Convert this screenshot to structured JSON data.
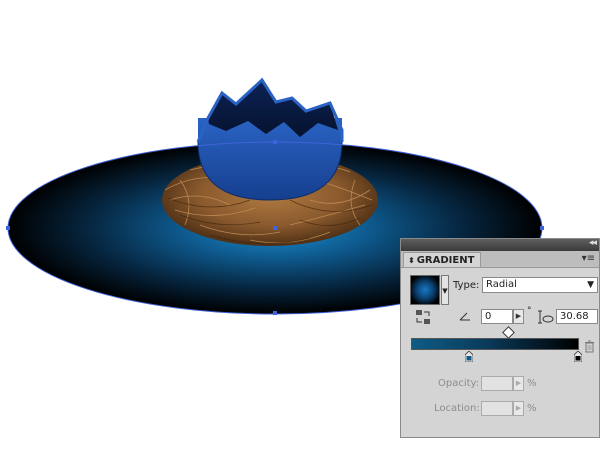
{
  "panel": {
    "collapse_glyph": "◂◂",
    "tab_arrows": "⬍",
    "tab_title": "GRADIENT",
    "menu_glyph": "▾≡",
    "type_label": "Type:",
    "type_value": "Radial",
    "angle_value": "0",
    "degree_symbol": "°",
    "aspect_value": "30.68",
    "opacity_label": "Opacity:",
    "opacity_value": "",
    "opacity_unit": "%",
    "location_label": "Location:",
    "location_value": "",
    "location_unit": "%",
    "stepper_glyph": "▶",
    "dropdown_glyph": "▼"
  },
  "colors": {
    "egg_blue": "#1d4fa8",
    "egg_dark": "#0a1f55",
    "glow_blue": "#1c8fd0",
    "nest_brown": "#8a5a2e",
    "selection_blue": "#3f63d8",
    "panel_bg": "#d4d4d4"
  }
}
